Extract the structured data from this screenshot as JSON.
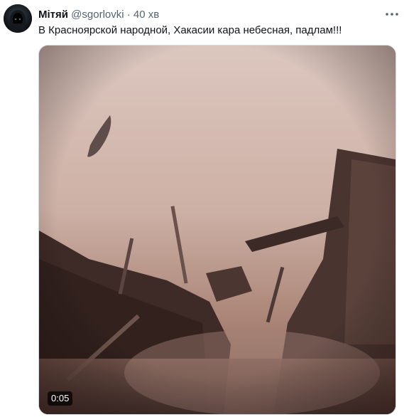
{
  "tweet": {
    "author": {
      "display_name": "Мітяй",
      "handle": "@sgorlovki",
      "avatar_icon": "hooded-figure-avatar"
    },
    "separator": "·",
    "timestamp": "40 хв",
    "text": "В Красноярской народной, Хакасии кара небесная, падлам!!!",
    "more_icon": "more-horizontal-icon",
    "media": {
      "type": "video",
      "duration": "0:05",
      "description_colors": {
        "sky_top": "#d9c2b9",
        "sky_mid": "#c7a89c",
        "dust": "#8a6a5e",
        "dark": "#3a2622"
      }
    }
  },
  "colors": {
    "text_primary": "#0f1419",
    "text_secondary": "#536471",
    "border": "#cfd9de"
  }
}
